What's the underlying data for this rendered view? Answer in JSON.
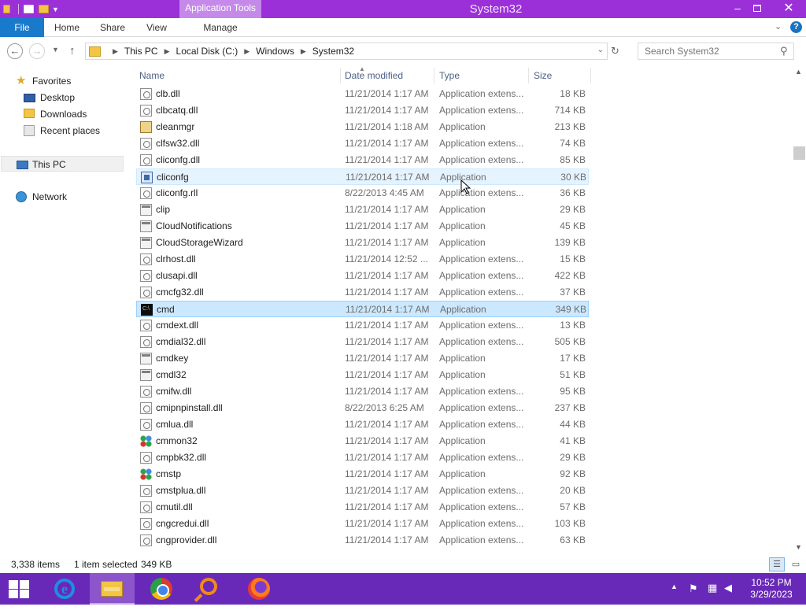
{
  "window": {
    "title": "System32",
    "context_tab": "Application Tools"
  },
  "ribbon": {
    "tabs": [
      "File",
      "Home",
      "Share",
      "View",
      "Manage"
    ]
  },
  "address": {
    "crumbs": [
      "This PC",
      "Local Disk (C:)",
      "Windows",
      "System32"
    ]
  },
  "search": {
    "placeholder": "Search System32"
  },
  "nav": {
    "favorites": "Favorites",
    "desktop": "Desktop",
    "downloads": "Downloads",
    "recent": "Recent places",
    "this_pc": "This PC",
    "network": "Network"
  },
  "columns": {
    "name": "Name",
    "date": "Date modified",
    "type": "Type",
    "size": "Size"
  },
  "files": [
    {
      "name": "clb.dll",
      "date": "11/21/2014 1:17 AM",
      "type": "Application extens...",
      "size": "18 KB",
      "icon": "dll"
    },
    {
      "name": "clbcatq.dll",
      "date": "11/21/2014 1:17 AM",
      "type": "Application extens...",
      "size": "714 KB",
      "icon": "dll"
    },
    {
      "name": "cleanmgr",
      "date": "11/21/2014 1:18 AM",
      "type": "Application",
      "size": "213 KB",
      "icon": "cleanmgr"
    },
    {
      "name": "clfsw32.dll",
      "date": "11/21/2014 1:17 AM",
      "type": "Application extens...",
      "size": "74 KB",
      "icon": "dll"
    },
    {
      "name": "cliconfg.dll",
      "date": "11/21/2014 1:17 AM",
      "type": "Application extens...",
      "size": "85 KB",
      "icon": "dll"
    },
    {
      "name": "cliconfg",
      "date": "11/21/2014 1:17 AM",
      "type": "Application",
      "size": "30 KB",
      "icon": "blue"
    },
    {
      "name": "cliconfg.rll",
      "date": "8/22/2013 4:45 AM",
      "type": "Application extens...",
      "size": "36 KB",
      "icon": "dll"
    },
    {
      "name": "clip",
      "date": "11/21/2014 1:17 AM",
      "type": "Application",
      "size": "29 KB",
      "icon": "exe"
    },
    {
      "name": "CloudNotifications",
      "date": "11/21/2014 1:17 AM",
      "type": "Application",
      "size": "45 KB",
      "icon": "exe"
    },
    {
      "name": "CloudStorageWizard",
      "date": "11/21/2014 1:17 AM",
      "type": "Application",
      "size": "139 KB",
      "icon": "exe"
    },
    {
      "name": "clrhost.dll",
      "date": "11/21/2014 12:52 ...",
      "type": "Application extens...",
      "size": "15 KB",
      "icon": "dll"
    },
    {
      "name": "clusapi.dll",
      "date": "11/21/2014 1:17 AM",
      "type": "Application extens...",
      "size": "422 KB",
      "icon": "dll"
    },
    {
      "name": "cmcfg32.dll",
      "date": "11/21/2014 1:17 AM",
      "type": "Application extens...",
      "size": "37 KB",
      "icon": "dll"
    },
    {
      "name": "cmd",
      "date": "11/21/2014 1:17 AM",
      "type": "Application",
      "size": "349 KB",
      "icon": "cmd"
    },
    {
      "name": "cmdext.dll",
      "date": "11/21/2014 1:17 AM",
      "type": "Application extens...",
      "size": "13 KB",
      "icon": "dll"
    },
    {
      "name": "cmdial32.dll",
      "date": "11/21/2014 1:17 AM",
      "type": "Application extens...",
      "size": "505 KB",
      "icon": "dll"
    },
    {
      "name": "cmdkey",
      "date": "11/21/2014 1:17 AM",
      "type": "Application",
      "size": "17 KB",
      "icon": "exe"
    },
    {
      "name": "cmdl32",
      "date": "11/21/2014 1:17 AM",
      "type": "Application",
      "size": "51 KB",
      "icon": "exe"
    },
    {
      "name": "cmifw.dll",
      "date": "11/21/2014 1:17 AM",
      "type": "Application extens...",
      "size": "95 KB",
      "icon": "dll"
    },
    {
      "name": "cmipnpinstall.dll",
      "date": "8/22/2013 6:25 AM",
      "type": "Application extens...",
      "size": "237 KB",
      "icon": "dll"
    },
    {
      "name": "cmlua.dll",
      "date": "11/21/2014 1:17 AM",
      "type": "Application extens...",
      "size": "44 KB",
      "icon": "dll"
    },
    {
      "name": "cmmon32",
      "date": "11/21/2014 1:17 AM",
      "type": "Application",
      "size": "41 KB",
      "icon": "green"
    },
    {
      "name": "cmpbk32.dll",
      "date": "11/21/2014 1:17 AM",
      "type": "Application extens...",
      "size": "29 KB",
      "icon": "dll"
    },
    {
      "name": "cmstp",
      "date": "11/21/2014 1:17 AM",
      "type": "Application",
      "size": "92 KB",
      "icon": "green"
    },
    {
      "name": "cmstplua.dll",
      "date": "11/21/2014 1:17 AM",
      "type": "Application extens...",
      "size": "20 KB",
      "icon": "dll"
    },
    {
      "name": "cmutil.dll",
      "date": "11/21/2014 1:17 AM",
      "type": "Application extens...",
      "size": "57 KB",
      "icon": "dll"
    },
    {
      "name": "cngcredui.dll",
      "date": "11/21/2014 1:17 AM",
      "type": "Application extens...",
      "size": "103 KB",
      "icon": "dll"
    },
    {
      "name": "cngprovider.dll",
      "date": "11/21/2014 1:17 AM",
      "type": "Application extens...",
      "size": "63 KB",
      "icon": "dll"
    }
  ],
  "selected_file": "cmd",
  "hovered_file": "cliconfg",
  "status": {
    "count": "3,338 items",
    "selection": "1 item selected",
    "size": "349 KB"
  },
  "taskbar": {
    "time": "10:52 PM",
    "date": "3/29/2023"
  },
  "colors": {
    "title_bar": "#9b30d9",
    "taskbar": "#6929b8",
    "file_tab": "#1979ca",
    "selection": "#cce8ff"
  }
}
